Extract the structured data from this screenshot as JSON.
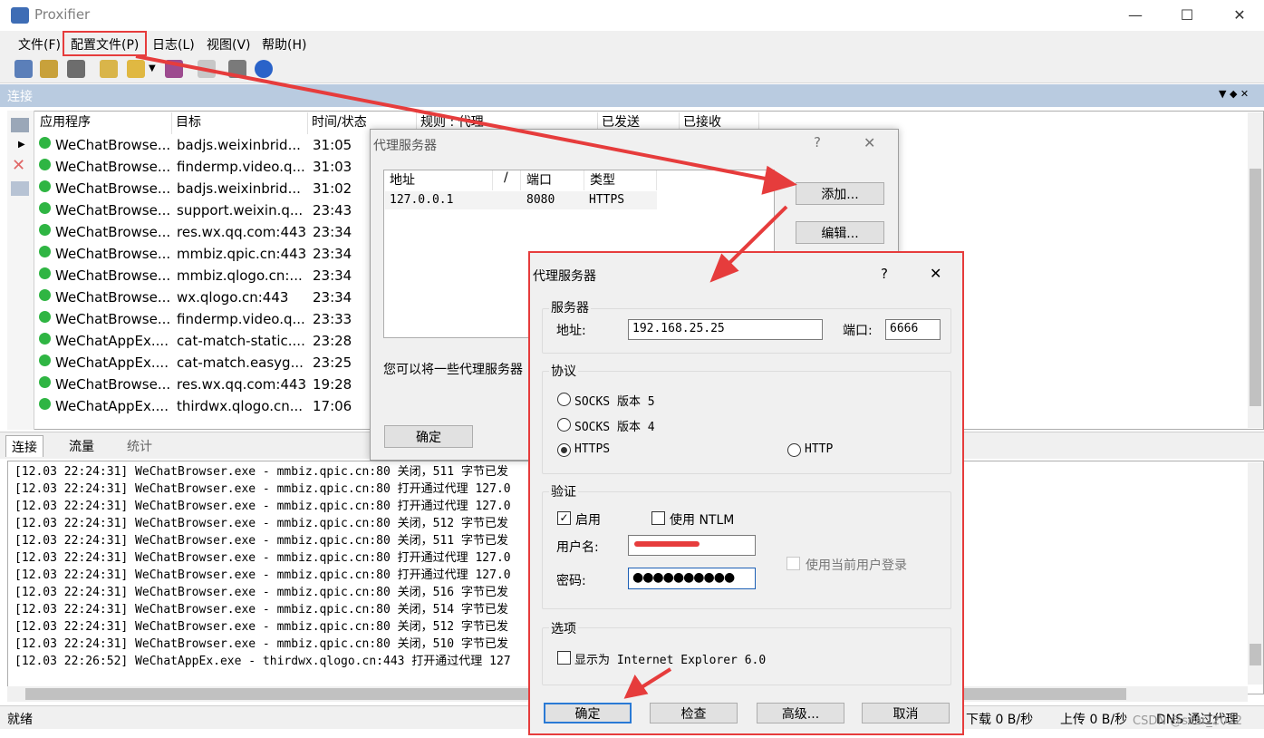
{
  "window": {
    "title": "Proxifier",
    "minimize": "—",
    "maximize": "☐",
    "close": "✕"
  },
  "menu": [
    "文件(F)",
    "配置文件(P)",
    "日志(L)",
    "视图(V)",
    "帮助(H)"
  ],
  "connections": {
    "title": "连接",
    "columns": [
      "应用程序",
      "目标",
      "时间/状态",
      "规则 : 代理",
      "已发送",
      "已接收"
    ],
    "rows": [
      {
        "app": "WeChatBrowse...",
        "target": "badjs.weixinbrid...",
        "time": "31:05"
      },
      {
        "app": "WeChatBrowse...",
        "target": "findermp.video.q...",
        "time": "31:03"
      },
      {
        "app": "WeChatBrowse...",
        "target": "badjs.weixinbrid...",
        "time": "31:02"
      },
      {
        "app": "WeChatBrowse...",
        "target": "support.weixin.q...",
        "time": "23:43"
      },
      {
        "app": "WeChatBrowse...",
        "target": "res.wx.qq.com:443",
        "time": "23:34"
      },
      {
        "app": "WeChatBrowse...",
        "target": "mmbiz.qpic.cn:443",
        "time": "23:34"
      },
      {
        "app": "WeChatBrowse...",
        "target": "mmbiz.qlogo.cn:...",
        "time": "23:34"
      },
      {
        "app": "WeChatBrowse...",
        "target": "wx.qlogo.cn:443",
        "time": "23:34"
      },
      {
        "app": "WeChatBrowse...",
        "target": "findermp.video.q...",
        "time": "23:33"
      },
      {
        "app": "WeChatAppEx....",
        "target": "cat-match-static....",
        "time": "23:28"
      },
      {
        "app": "WeChatAppEx....",
        "target": "cat-match.easyg...",
        "time": "23:25"
      },
      {
        "app": "WeChatBrowse...",
        "target": "res.wx.qq.com:443",
        "time": "19:28"
      },
      {
        "app": "WeChatAppEx....",
        "target": "thirdwx.qlogo.cn...",
        "time": "17:06"
      }
    ]
  },
  "tabs": [
    "连接",
    "流量",
    "统计"
  ],
  "log": [
    "[12.03 22:24:31] WeChatBrowser.exe - mmbiz.qpic.cn:80 关闭，511 字节已发",
    "[12.03 22:24:31] WeChatBrowser.exe - mmbiz.qpic.cn:80 打开通过代理 127.0",
    "[12.03 22:24:31] WeChatBrowser.exe - mmbiz.qpic.cn:80 打开通过代理 127.0",
    "[12.03 22:24:31] WeChatBrowser.exe - mmbiz.qpic.cn:80 关闭，512 字节已发",
    "[12.03 22:24:31] WeChatBrowser.exe - mmbiz.qpic.cn:80 关闭，511 字节已发",
    "[12.03 22:24:31] WeChatBrowser.exe - mmbiz.qpic.cn:80 打开通过代理 127.0",
    "[12.03 22:24:31] WeChatBrowser.exe - mmbiz.qpic.cn:80 打开通过代理 127.0",
    "[12.03 22:24:31] WeChatBrowser.exe - mmbiz.qpic.cn:80 关闭，516 字节已发",
    "[12.03 22:24:31] WeChatBrowser.exe - mmbiz.qpic.cn:80 关闭，514 字节已发",
    "[12.03 22:24:31] WeChatBrowser.exe - mmbiz.qpic.cn:80 关闭，512 字节已发",
    "[12.03 22:24:31] WeChatBrowser.exe - mmbiz.qpic.cn:80 关闭，510 字节已发",
    "[12.03 22:26:52] WeChatAppEx.exe - thirdwx.qlogo.cn:443 打开通过代理 127"
  ],
  "status": {
    "left": "就绪",
    "download": "下载 0 B/秒",
    "upload": "上传 0 B/秒",
    "dns": "DNS 通过代理",
    "watermark": "CSDN @scar_2022"
  },
  "dialog1": {
    "title": "代理服务器",
    "help": "?",
    "close": "✕",
    "columns": [
      "地址",
      "/",
      "端口",
      "类型"
    ],
    "row": {
      "address": "127.0.0.1",
      "port": "8080",
      "type": "HTTPS"
    },
    "add": "添加...",
    "edit": "编辑...",
    "note": "您可以将一些代理服务器",
    "ok": "确定"
  },
  "dialog2": {
    "title": "代理服务器",
    "help": "?",
    "close": "✕",
    "server_group": "服务器",
    "address_label": "地址:",
    "address_value": "192.168.25.25",
    "port_label": "端口:",
    "port_value": "6666",
    "protocol_group": "协议",
    "socks5": "SOCKS 版本 5",
    "socks4": "SOCKS 版本 4",
    "https": "HTTPS",
    "http": "HTTP",
    "auth_group": "验证",
    "enable": "启用",
    "ntlm": "使用 NTLM",
    "user_label": "用户名:",
    "pass_label": "密码:",
    "password_value": "●●●●●●●●●●",
    "current_user": "使用当前用户登录",
    "options_group": "选项",
    "ie": "显示为 Internet Explorer 6.0",
    "ok": "确定",
    "check": "检查",
    "advanced": "高级...",
    "cancel": "取消"
  },
  "colors": {
    "accent_red": "#e63c3c",
    "header_blue": "#b9cbe0",
    "app_green": "#2fb543"
  }
}
